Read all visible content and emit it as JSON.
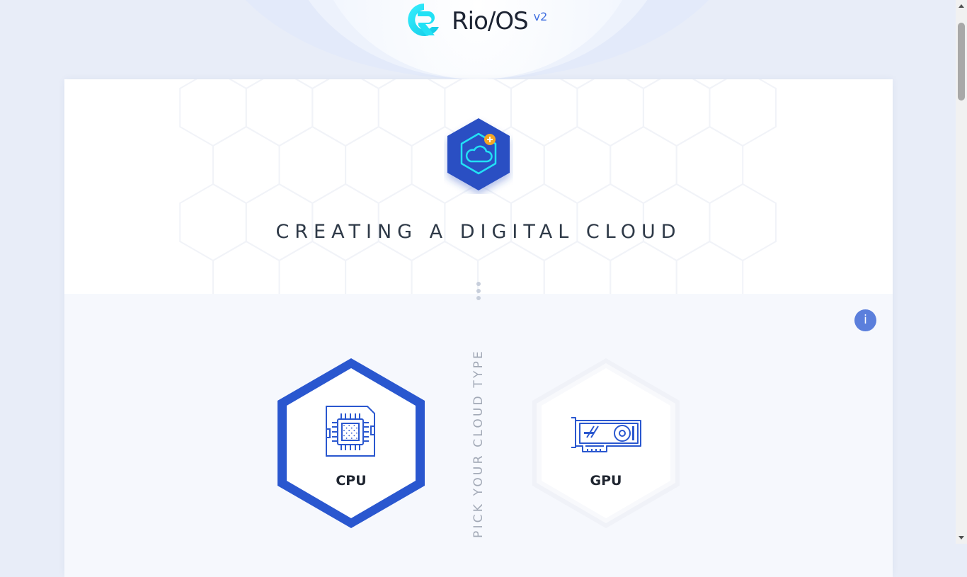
{
  "header": {
    "brand_name": "Rio/OS",
    "version": "v2",
    "logo_icon": "rio-logo-icon"
  },
  "hero": {
    "icon": "cloud-add-icon",
    "title": "CREATING A DIGITAL CLOUD"
  },
  "info_button": {
    "label": "i"
  },
  "cloud_type": {
    "prompt": "PICK YOUR CLOUD TYPE",
    "options": [
      {
        "label": "CPU",
        "icon": "cpu-chip-icon",
        "selected": true
      },
      {
        "label": "GPU",
        "icon": "gpu-card-icon",
        "selected": false
      }
    ]
  },
  "colors": {
    "accent": "#2a57cf",
    "hero_badge": "#2c4fc3",
    "cyan": "#1fd8f2",
    "plus_badge": "#f5a623",
    "info": "#5b7fdc"
  }
}
